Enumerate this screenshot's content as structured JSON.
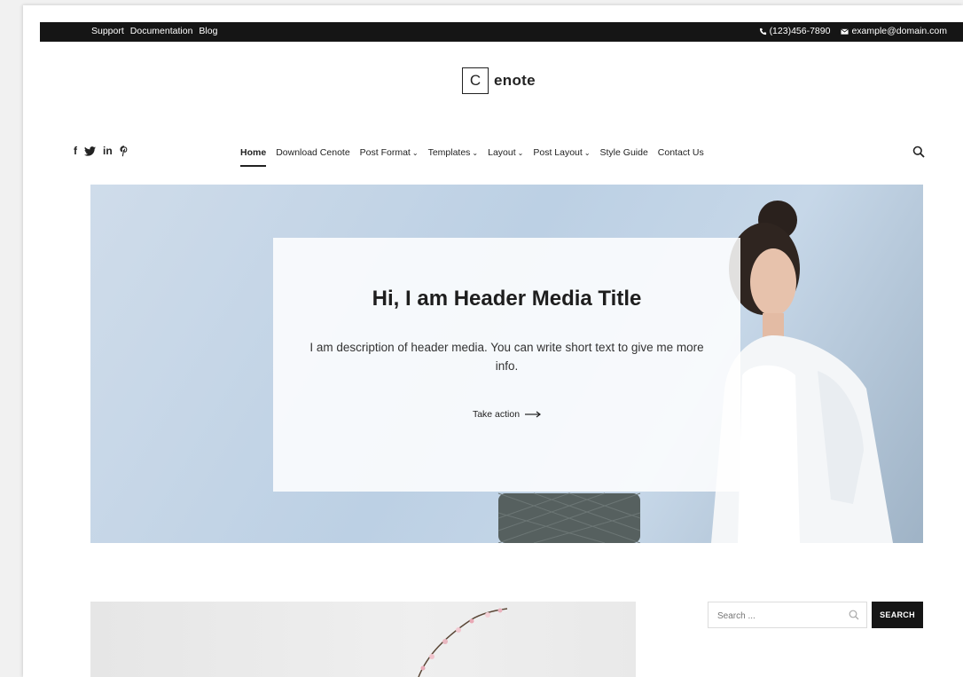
{
  "topbar": {
    "links": [
      "Support",
      "Documentation",
      "Blog"
    ],
    "phone": "(123)456-7890",
    "email": "example@domain.com"
  },
  "logo": {
    "letter": "C",
    "rest": "enote"
  },
  "social": [
    {
      "icon": "facebook-icon",
      "glyph": "f"
    },
    {
      "icon": "twitter-icon",
      "glyph": "𝕥"
    },
    {
      "icon": "linkedin-icon",
      "glyph": "in"
    },
    {
      "icon": "pinterest-icon",
      "glyph": "P"
    }
  ],
  "nav": [
    {
      "label": "Home",
      "active": true,
      "dropdown": false
    },
    {
      "label": "Download Cenote",
      "active": false,
      "dropdown": false
    },
    {
      "label": "Post Format",
      "active": false,
      "dropdown": true
    },
    {
      "label": "Templates",
      "active": false,
      "dropdown": true
    },
    {
      "label": "Layout",
      "active": false,
      "dropdown": true
    },
    {
      "label": "Post Layout",
      "active": false,
      "dropdown": true
    },
    {
      "label": "Style Guide",
      "active": false,
      "dropdown": false
    },
    {
      "label": "Contact Us",
      "active": false,
      "dropdown": false
    }
  ],
  "hero": {
    "title": "Hi, I am Header Media Title",
    "description": "I am description of header media. You can write short text to give me more info.",
    "cta": "Take action"
  },
  "sidebar": {
    "search_placeholder": "Search ...",
    "search_button": "SEARCH"
  }
}
